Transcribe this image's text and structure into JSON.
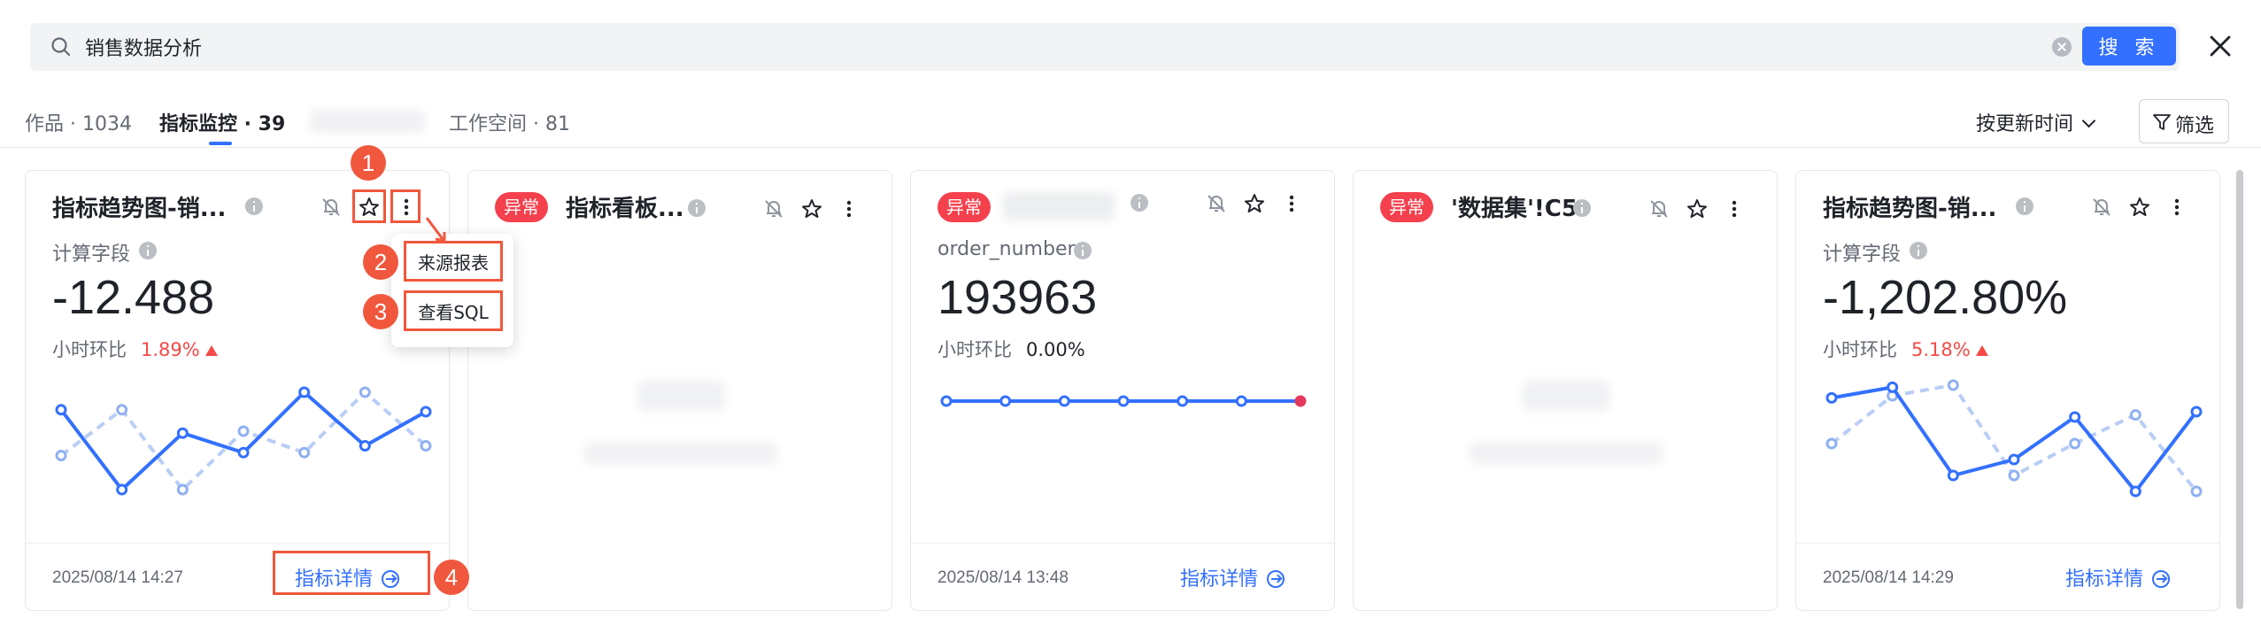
{
  "search": {
    "value": "销售数据分析",
    "button_label": "搜 索"
  },
  "tabs": [
    {
      "label": "作品 · 1034"
    },
    {
      "label": "指标监控 · 39"
    },
    {
      "label": "工作空间 · 81"
    }
  ],
  "sort": {
    "label": "按更新时间"
  },
  "filter": {
    "label": "筛选"
  },
  "cards": [
    {
      "title": "指标趋势图-销...",
      "field_label": "计算字段",
      "value": "-12.488",
      "compare_label": "小时环比",
      "compare_value": "1.89%",
      "compare_trend": "up",
      "timestamp": "2025/08/14 14:27",
      "link_label": "指标详情"
    },
    {
      "badge": "异常",
      "title": "指标看板...",
      "timestamp": "",
      "link_label": ""
    },
    {
      "badge": "异常",
      "field_label": "order_number",
      "value": "193963",
      "compare_label": "小时环比",
      "compare_value": "0.00%",
      "timestamp": "2025/08/14 13:48",
      "link_label": "指标详情"
    },
    {
      "badge": "异常",
      "title": "'数据集'!C5"
    },
    {
      "title": "指标趋势图-销...",
      "field_label": "计算字段",
      "value": "-1,202.80%",
      "compare_label": "小时环比",
      "compare_value": "5.18%",
      "compare_trend": "up",
      "timestamp": "2025/08/14 14:29",
      "link_label": "指标详情"
    }
  ],
  "menu": {
    "items": [
      "来源报表",
      "查看SQL"
    ]
  },
  "callouts": [
    "1",
    "2",
    "3",
    "4"
  ],
  "colors": {
    "primary": "#3370ff",
    "danger": "#f54a45",
    "annotation": "#f0573d",
    "series_dashed": "#b9cdf7"
  },
  "chart_data": [
    {
      "type": "line",
      "card": 1,
      "x": [
        0,
        1,
        2,
        3,
        4,
        5,
        6,
        7,
        8,
        9,
        10
      ],
      "series": [
        {
          "style": "solid",
          "values": [
            0.82,
            0.0,
            0.58,
            0.38,
            1.0,
            0.45,
            0.8
          ]
        },
        {
          "style": "dashed",
          "values": [
            0.35,
            0.82,
            0.0,
            0.6,
            0.38,
            1.0,
            0.45
          ]
        }
      ]
    },
    {
      "type": "line",
      "card": 3,
      "x": [
        0,
        1,
        2,
        3,
        4,
        5,
        6
      ],
      "series": [
        {
          "style": "solid",
          "values": [
            0,
            0,
            0,
            0,
            0,
            0,
            0
          ]
        }
      ]
    },
    {
      "type": "line",
      "card": 5,
      "x": [
        0,
        1,
        2,
        3,
        4,
        5,
        6,
        7,
        8,
        9,
        10
      ],
      "series": [
        {
          "style": "solid",
          "values": [
            0.88,
            0.98,
            0.15,
            0.3,
            0.7,
            0.0,
            0.75
          ]
        },
        {
          "style": "dashed",
          "values": [
            0.45,
            0.9,
            1.0,
            0.15,
            0.45,
            0.72,
            0.0
          ]
        }
      ]
    }
  ]
}
